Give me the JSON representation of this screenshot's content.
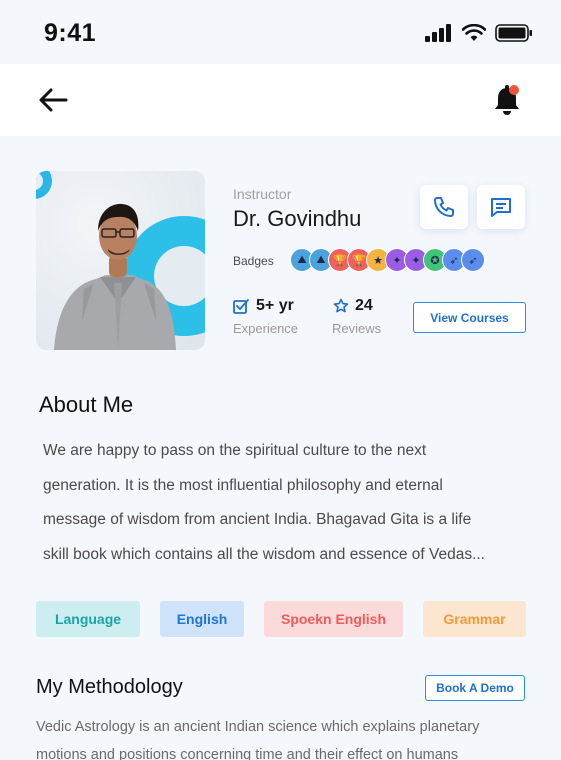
{
  "status_bar": {
    "time": "9:41"
  },
  "profile": {
    "role": "Instructor",
    "name": "Dr. Govindhu",
    "badges_label": "Badges",
    "badges": [
      {
        "icon": "hiker-icon",
        "color": "#4aa3df",
        "glyph": "⛰"
      },
      {
        "icon": "hiker-icon",
        "color": "#4aa3df",
        "glyph": "⛰"
      },
      {
        "icon": "trophy-icon",
        "color": "#f0605d",
        "glyph": "🏆"
      },
      {
        "icon": "trophy-icon",
        "color": "#f0605d",
        "glyph": "🏆"
      },
      {
        "icon": "medal-icon",
        "color": "#f4b340",
        "glyph": "★"
      },
      {
        "icon": "bug-icon",
        "color": "#9b5de5",
        "glyph": "✦"
      },
      {
        "icon": "bug-icon",
        "color": "#9b5de5",
        "glyph": "✦"
      },
      {
        "icon": "award-icon",
        "color": "#3fc47a",
        "glyph": "✪"
      },
      {
        "icon": "rocket-icon",
        "color": "#5b8def",
        "glyph": "➶"
      },
      {
        "icon": "rocket-icon",
        "color": "#5b8def",
        "glyph": "➶"
      }
    ],
    "experience_value": "5+ yr",
    "experience_label": "Experience",
    "reviews_value": "24",
    "reviews_label": "Reviews",
    "view_courses_label": "View Courses"
  },
  "about": {
    "title": "About Me",
    "lines": [
      "We are happy to pass on the spiritual culture to the next",
      "generation. It is the most influential philosophy and eternal",
      "message of wisdom from ancient India. Bhagavad Gita is a life",
      "skill book which contains all the wisdom and essence of Vedas..."
    ]
  },
  "tags": [
    {
      "label": "Language",
      "bg": "#cdeef0",
      "color": "#1ba4a8"
    },
    {
      "label": "English",
      "bg": "#cfe3fb",
      "color": "#1f74d6"
    },
    {
      "label": "Spoekn English",
      "bg": "#fbdada",
      "color": "#ef5b5b"
    },
    {
      "label": "Grammar",
      "bg": "#fde6cf",
      "color": "#f29a3c"
    }
  ],
  "methodology": {
    "title": "My Methodology",
    "book_demo_label": "Book A Demo",
    "lines": [
      "Vedic Astrology is an ancient Indian science which explains planetary",
      "motions and positions concerning time and their effect on humans"
    ]
  },
  "colors": {
    "accent": "#1f6fd1",
    "background": "#f4f8fc",
    "notification_dot": "#f0543a"
  }
}
